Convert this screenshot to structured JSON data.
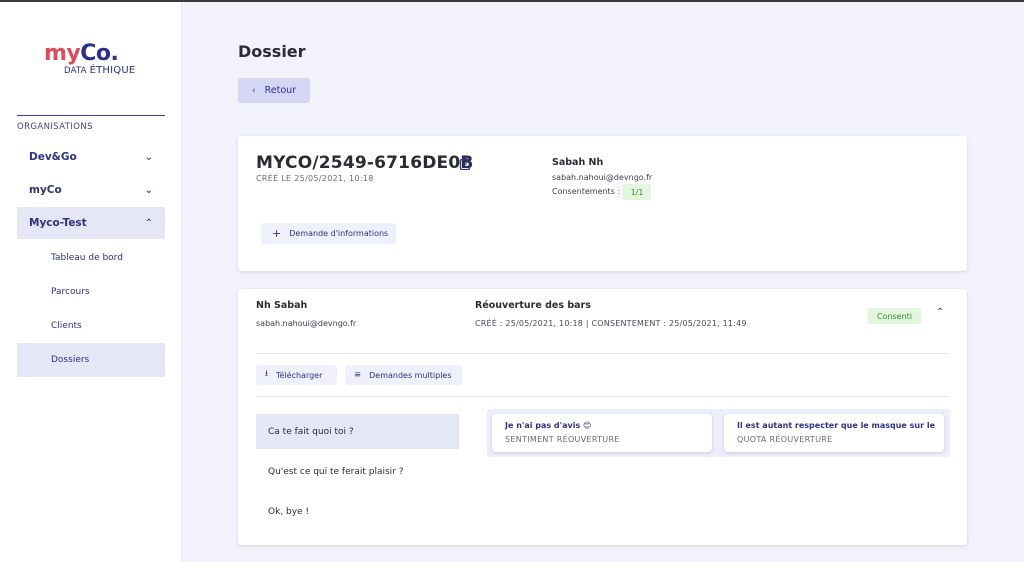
{
  "sidebar": {
    "logo": {
      "my": "my",
      "co": "Co.",
      "data": "DATA ",
      "ethique": "ÉTHIQUE"
    },
    "heading": "ORGANISATIONS",
    "orgs": [
      {
        "label": "Dev&Go",
        "chevron": "chevron-down-icon"
      },
      {
        "label": "myCo",
        "chevron": "chevron-down-icon"
      },
      {
        "label": "Myco-Test",
        "chevron": "chevron-up-icon"
      }
    ],
    "sub_items": [
      "Tableau de bord",
      "Parcours",
      "Clients",
      "Dossiers"
    ]
  },
  "header": {
    "title": "Dossier",
    "back_label": "Retour"
  },
  "dossier": {
    "reference": "MYCO/2549-6716DE0B",
    "created": "CRÉÉ LE 25/05/2021, 10:18",
    "contact_name": "Sabah Nh",
    "contact_email": "sabah.nahoui@devngo.fr",
    "consent_label": "Consentements :",
    "consent_value": "1/1",
    "info_request_label": "Demande d'informations"
  },
  "parcours": {
    "person_name": "Nh Sabah",
    "person_email": "sabah.nahoui@devngo.fr",
    "title": "Réouverture des bars",
    "dates": "CRÉÉ : 25/05/2021, 10:18 | CONSENTEMENT : 25/05/2021, 11:49",
    "status": "Consenti",
    "download_label": "Télécharger",
    "multi_requests_label": "Demandes multiples",
    "questions": [
      "Ca te fait quoi toi ?",
      "Qu'est ce qui te ferait plaisir ?",
      "Ok, bye !"
    ],
    "answers": [
      {
        "value": "Je n'ai pas d'avis 😊",
        "key": "SENTIMENT RÉOUVERTURE"
      },
      {
        "value": "Il est autant respecter que le masque sur le ne...",
        "key": "QUOTA RÉOUVERTURE"
      }
    ]
  },
  "colors": {
    "accent": "#2e3187",
    "brand_red": "#e24a5b",
    "badge_green": "#3b8a2f",
    "active_bg": "#e5e6f6"
  }
}
